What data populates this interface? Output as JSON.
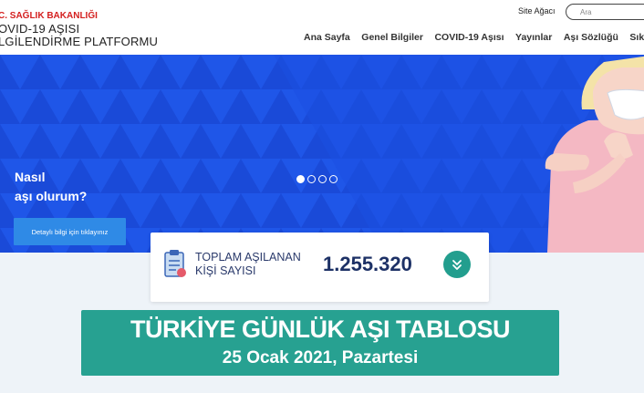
{
  "header": {
    "ministry": "C. SAĞLIK BAKANLIĞI",
    "platform_line1": "OVID-19 AŞISI",
    "platform_line2": "LGİLENDİRME PLATFORMU",
    "sitemap": "Site Ağacı",
    "search_placeholder": "Ara"
  },
  "nav": [
    {
      "label": "Ana Sayfa"
    },
    {
      "label": "Genel Bilgiler"
    },
    {
      "label": "COVID-19 Aşısı"
    },
    {
      "label": "Yayınlar"
    },
    {
      "label": "Aşı Sözlüğü"
    },
    {
      "label": "Sıkça Sor"
    }
  ],
  "hero": {
    "title_line1": "Nasıl",
    "title_line2": "aşı olurum?",
    "cta_label": "Detaylı bilgi için tıklayınız",
    "slides_total": 4,
    "active_slide": 1
  },
  "stat": {
    "label_line1": "TOPLAM AŞILANAN",
    "label_line2": "KİŞİ SAYISI",
    "value": "1.255.320"
  },
  "banner": {
    "title": "TÜRKİYE GÜNLÜK AŞI TABLOSU",
    "date": "25 Ocak 2021, Pazartesi"
  },
  "colors": {
    "hero_blue": "#1b4fe0",
    "teal": "#27a191",
    "ministry_red": "#d4201f",
    "navy": "#1d3166"
  }
}
